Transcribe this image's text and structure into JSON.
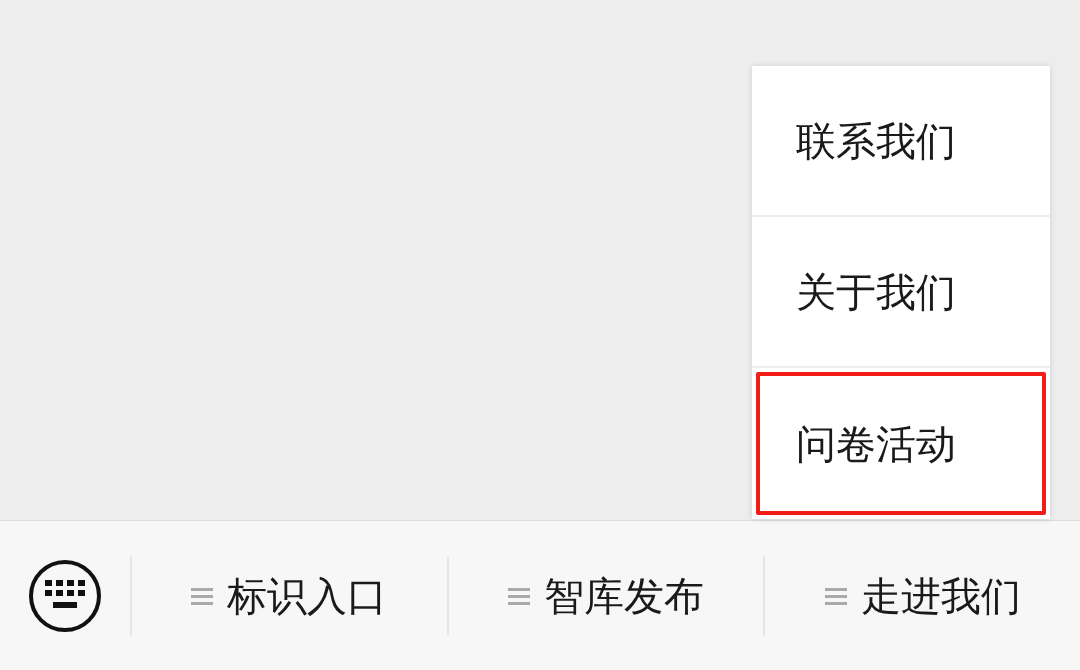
{
  "popup_menu": {
    "items": [
      {
        "label": "联系我们",
        "highlighted": false
      },
      {
        "label": "关于我们",
        "highlighted": false
      },
      {
        "label": "问卷活动",
        "highlighted": true
      }
    ]
  },
  "menu_bar": {
    "items": [
      {
        "label": "标识入口"
      },
      {
        "label": "智库发布"
      },
      {
        "label": "走进我们"
      }
    ]
  }
}
